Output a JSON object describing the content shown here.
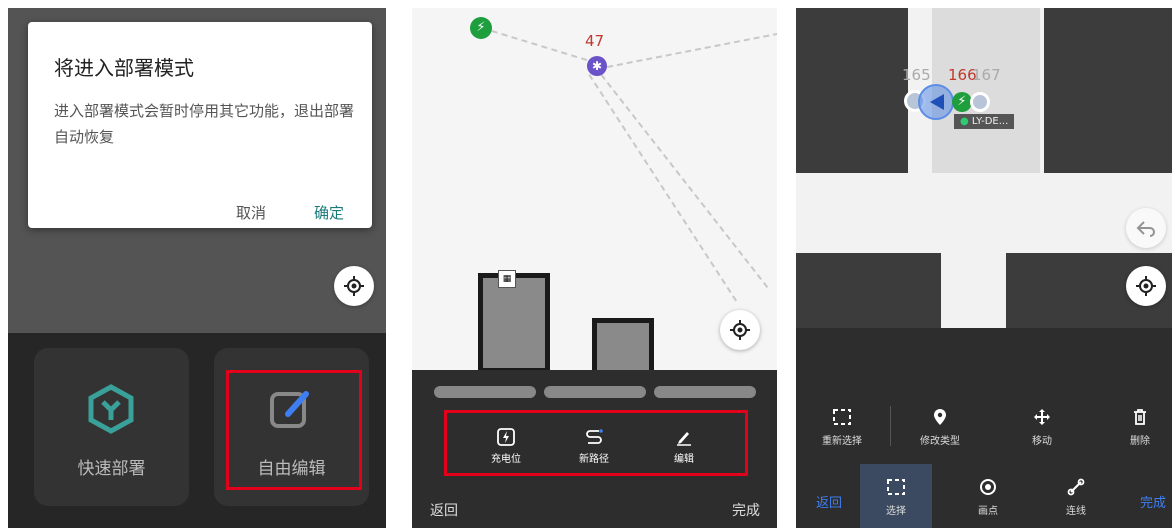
{
  "panel1": {
    "dialog": {
      "title": "将进入部署模式",
      "message": "进入部署模式会暂时停用其它功能，退出部署自动恢复",
      "cancel": "取消",
      "confirm": "确定"
    },
    "cards": [
      {
        "label": "快速部署",
        "icon": "quick-deploy-icon"
      },
      {
        "label": "自由编辑",
        "icon": "edit-icon"
      }
    ]
  },
  "panel2": {
    "point_label": "47",
    "tools": [
      {
        "label": "充电位",
        "icon": "charging-icon"
      },
      {
        "label": "新路径",
        "icon": "path-icon"
      },
      {
        "label": "编辑",
        "icon": "pencil-icon"
      }
    ],
    "back": "返回",
    "done": "完成"
  },
  "panel3": {
    "point_labels": [
      "165",
      "166",
      "167"
    ],
    "robot_tag": "LY-DE...",
    "edit_actions": [
      {
        "label": "重新选择",
        "icon": "reselect-icon"
      },
      {
        "label": "修改类型",
        "icon": "location-pin-icon"
      },
      {
        "label": "移动",
        "icon": "move-icon"
      },
      {
        "label": "删除",
        "icon": "trash-icon"
      }
    ],
    "nav": {
      "back": "返回",
      "tabs": [
        {
          "label": "选择",
          "icon": "select-icon",
          "selected": true
        },
        {
          "label": "画点",
          "icon": "draw-point-icon"
        },
        {
          "label": "连线",
          "icon": "connect-line-icon"
        }
      ],
      "done": "完成"
    }
  },
  "colors": {
    "highlight": "#e3001b",
    "accent_teal": "#1a7a7a",
    "nav_blue": "#3f7ef0",
    "number_red": "#c0392b",
    "charger_green": "#1e9e3c",
    "waypoint_purple": "#6a53c9"
  }
}
